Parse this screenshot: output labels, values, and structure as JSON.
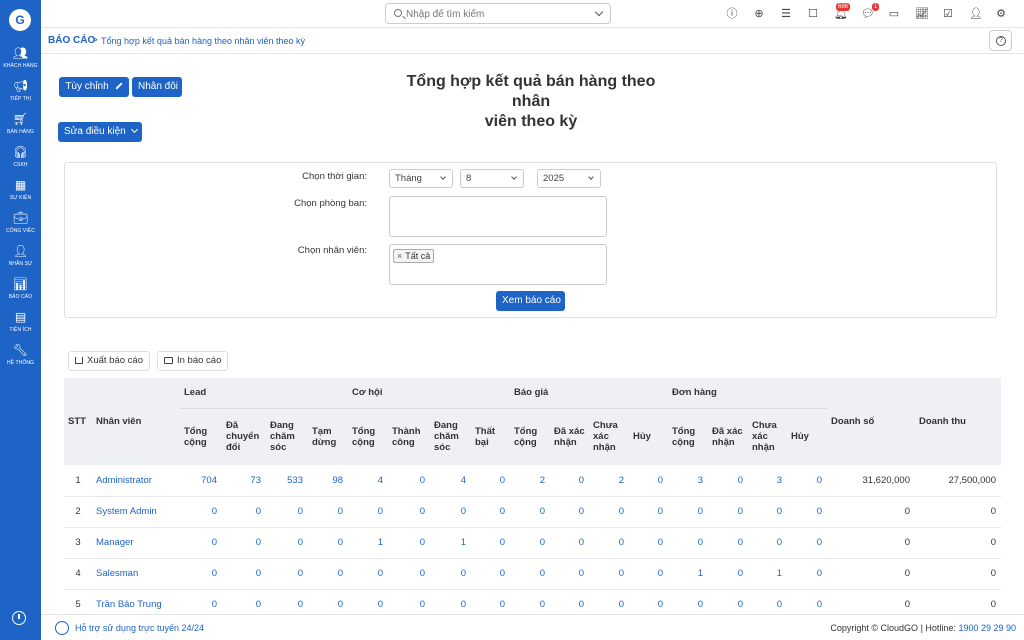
{
  "sidebar": {
    "items": [
      {
        "label": "KHÁCH HÀNG",
        "icon": "users-icon"
      },
      {
        "label": "TIẾP THỊ",
        "icon": "megaphone-icon"
      },
      {
        "label": "BÁN HÀNG",
        "icon": "cart-icon"
      },
      {
        "label": "CSKH",
        "icon": "headset-icon"
      },
      {
        "label": "SỰ KIỆN",
        "icon": "calendar-icon"
      },
      {
        "label": "CÔNG VIỆC",
        "icon": "briefcase-icon"
      },
      {
        "label": "NHÂN SỰ",
        "icon": "person-icon"
      },
      {
        "label": "BÁO CÁO",
        "icon": "chart-icon"
      },
      {
        "label": "TIỆN ÍCH",
        "icon": "utilities-icon"
      },
      {
        "label": "HỆ THỐNG",
        "icon": "wrench-icon"
      }
    ]
  },
  "header": {
    "search_placeholder": "Nhập để tìm kiếm",
    "notification_count": "696",
    "message_count": "1"
  },
  "breadcrumb": {
    "root": "BÁO CÁO",
    "separator": ">",
    "current": "Tổng hợp kết quả bán hàng theo nhân viên theo kỳ"
  },
  "toolbar": {
    "customize_label": "Tùy chỉnh",
    "duplicate_label": "Nhân đôi",
    "edit_conditions_label": "Sửa điều kiện"
  },
  "report": {
    "title_line1": "Tổng hợp kết quả bán hàng theo nhân",
    "title_line2": "viên theo kỳ"
  },
  "filters": {
    "time_label": "Chọn thời gian:",
    "period_type": "Tháng",
    "month": "8",
    "year": "2025",
    "department_label": "Chọn phòng ban:",
    "employee_label": "Chọn nhân viên:",
    "employee_tag": "Tất cả",
    "tag_remove": "×",
    "view_button": "Xem báo cáo"
  },
  "actions": {
    "export_label": "Xuất báo cáo",
    "print_label": "In báo cáo"
  },
  "table": {
    "col_stt": "STT",
    "col_employee": "Nhân viên",
    "groups": {
      "lead": "Lead",
      "opportunity": "Cơ hội",
      "quote": "Báo giá",
      "order": "Đơn hàng"
    },
    "col_revenue": "Doanh số",
    "col_income": "Doanh thu",
    "sub": {
      "lead": [
        "Tổng cộng",
        "Đã chuyển đổi",
        "Đang chăm sóc",
        "Tạm dừng"
      ],
      "opportunity": [
        "Tổng cộng",
        "Thành công",
        "Đang chăm sóc",
        "Thất bại"
      ],
      "quote": [
        "Tổng cộng",
        "Đã xác nhận",
        "Chưa xác nhận",
        "Hủy"
      ],
      "order": [
        "Tổng cộng",
        "Đã xác nhận",
        "Chưa xác nhận",
        "Hủy"
      ]
    },
    "rows": [
      {
        "stt": "1",
        "name": "Administrator",
        "values": [
          "704",
          "73",
          "533",
          "98",
          "4",
          "0",
          "4",
          "0",
          "2",
          "0",
          "2",
          "0",
          "3",
          "0",
          "3",
          "0"
        ],
        "revenue": "31,620,000",
        "income": "27,500,000"
      },
      {
        "stt": "2",
        "name": "System Admin",
        "values": [
          "0",
          "0",
          "0",
          "0",
          "0",
          "0",
          "0",
          "0",
          "0",
          "0",
          "0",
          "0",
          "0",
          "0",
          "0",
          "0"
        ],
        "revenue": "0",
        "income": "0"
      },
      {
        "stt": "3",
        "name": "Manager",
        "values": [
          "0",
          "0",
          "0",
          "0",
          "1",
          "0",
          "1",
          "0",
          "0",
          "0",
          "0",
          "0",
          "0",
          "0",
          "0",
          "0"
        ],
        "revenue": "0",
        "income": "0"
      },
      {
        "stt": "4",
        "name": "Salesman",
        "values": [
          "0",
          "0",
          "0",
          "0",
          "0",
          "0",
          "0",
          "0",
          "0",
          "0",
          "0",
          "0",
          "1",
          "0",
          "1",
          "0"
        ],
        "revenue": "0",
        "income": "0"
      },
      {
        "stt": "5",
        "name": "Trần Bảo Trung",
        "values": [
          "0",
          "0",
          "0",
          "0",
          "0",
          "0",
          "0",
          "0",
          "0",
          "0",
          "0",
          "0",
          "0",
          "0",
          "0",
          "0"
        ],
        "revenue": "0",
        "income": "0"
      }
    ]
  },
  "footer": {
    "support_text": "Hỗ trợ sử dụng trực tuyến 24/24",
    "copyright": "Copyright © CloudGO",
    "hotline_label": "| Hotline: ",
    "hotline": "1900 29 29 90"
  }
}
